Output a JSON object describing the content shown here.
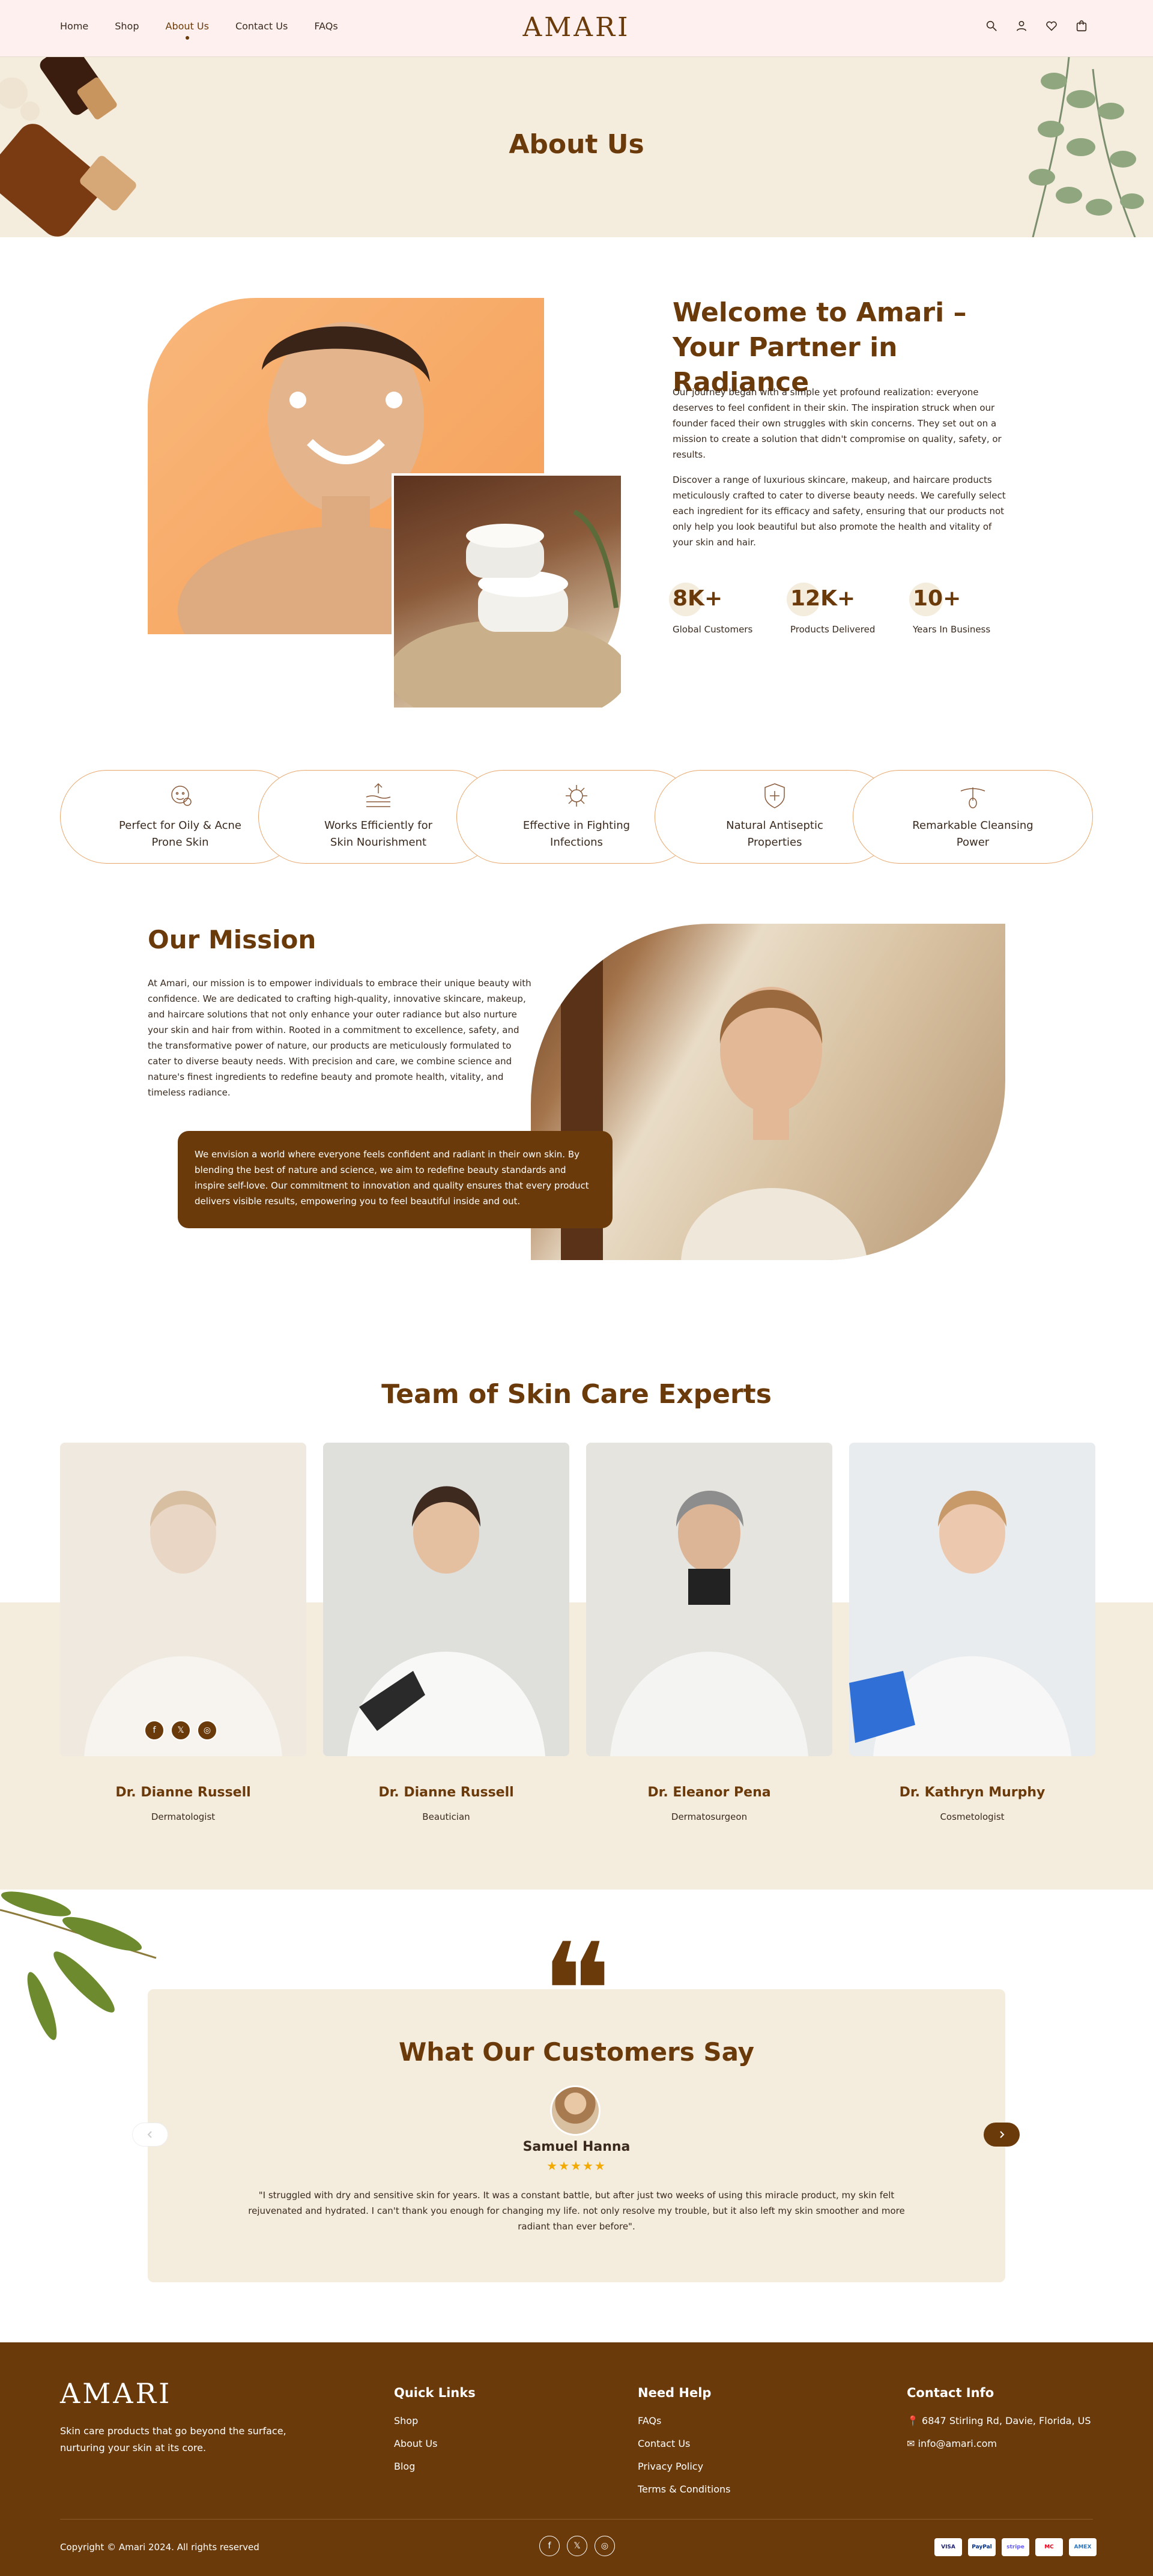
{
  "header": {
    "nav": [
      "Home",
      "Shop",
      "About Us",
      "Contact Us",
      "FAQs"
    ],
    "logo": "AMARI",
    "icons": [
      "search-icon",
      "user-icon",
      "heart-icon",
      "cart-icon"
    ]
  },
  "banner": {
    "title": "About Us"
  },
  "welcome": {
    "title": "Welcome to Amari – Your Partner in Radiance",
    "p1": "Our journey began with a simple yet profound realization: everyone deserves to feel confident in their skin. The inspiration struck when our founder faced their own struggles with skin concerns. They set out on a mission to create a solution that didn't compromise on quality, safety, or results.",
    "p2": "Discover a range of luxurious skincare, makeup, and haircare products meticulously crafted to cater to diverse beauty needs. We carefully select each ingredient for its efficacy and safety, ensuring that our products not only help you look beautiful but also promote the health and vitality of your skin and hair.",
    "stats": [
      {
        "num": "8K+",
        "label": "Global Customers"
      },
      {
        "num": "12K+",
        "label": "Products Delivered"
      },
      {
        "num": "10+",
        "label": "Years In Business"
      }
    ]
  },
  "features": [
    {
      "l1": "Perfect for Oily & Acne",
      "l2": "Prone Skin",
      "icon": "face-icon"
    },
    {
      "l1": "Works Efficiently for",
      "l2": "Skin Nourishment",
      "icon": "skin-layers-icon"
    },
    {
      "l1": "Effective in Fighting",
      "l2": "Infections",
      "icon": "virus-icon"
    },
    {
      "l1": "Natural Antiseptic",
      "l2": "Properties",
      "icon": "shield-plus-icon"
    },
    {
      "l1": "Remarkable Cleansing",
      "l2": "Power",
      "icon": "hair-follicle-icon"
    }
  ],
  "mission": {
    "title": "Our Mission",
    "text": "At Amari, our mission is to empower individuals to embrace their unique beauty with confidence. We are dedicated to crafting high-quality, innovative skincare, makeup, and haircare solutions that not only enhance your outer radiance but also nurture your skin and hair from within. Rooted in a commitment to excellence, safety, and the transformative power of nature, our products are meticulously formulated to cater to diverse beauty needs. With precision and care, we combine science and nature's finest ingredients to redefine beauty and promote health, vitality, and timeless radiance.",
    "vision": "We envision a world where everyone feels confident and radiant in their own skin. By blending the best of nature and science, we aim to redefine beauty standards and inspire self-love. Our commitment to innovation and quality ensures that every product delivers visible results, empowering you to feel beautiful inside and out."
  },
  "team": {
    "title": "Team of Skin Care Experts",
    "members": [
      {
        "name": "Dr. Dianne Russell",
        "role": "Dermatologist"
      },
      {
        "name": "Dr. Dianne Russell",
        "role": "Beautician"
      },
      {
        "name": "Dr. Eleanor Pena",
        "role": "Dermatosurgeon"
      },
      {
        "name": "Dr. Kathryn Murphy",
        "role": "Cosmetologist"
      }
    ],
    "social": [
      "facebook-icon",
      "x-icon",
      "instagram-icon"
    ]
  },
  "testimonials": {
    "title": "What Our Customers Say",
    "name": "Samuel Hanna",
    "stars": "★★★★★",
    "rating": 5,
    "text": "\"I struggled with dry and sensitive skin for years. It was a constant battle, but after just two weeks of using this miracle product, my skin felt rejuvenated and hydrated. I can't thank you enough for changing my life. not only resolve my trouble, but it also left my skin smoother and more radiant than ever before\"."
  },
  "footer": {
    "logo": "AMARI",
    "tagline": "Skin care products that go beyond the surface, nurturing your skin at its core.",
    "quick_title": "Quick Links",
    "quick": [
      "Shop",
      "About Us",
      "Blog"
    ],
    "help_title": "Need Help",
    "help": [
      "FAQs",
      "Contact Us",
      "Privacy Policy",
      "Terms & Conditions"
    ],
    "contact_title": "Contact Info",
    "address": "6847 Stirling Rd, Davie, Florida, US",
    "email": "info@amari.com",
    "copyright": "Copyright © Amari 2024. All rights reserved",
    "payments": [
      "VISA",
      "PayPal",
      "stripe",
      "MC",
      "AMEX"
    ]
  },
  "colors": {
    "brand": "#6b3a0a",
    "cream": "#f4ecdc",
    "header_bg": "#fdf0ee",
    "star": "#f2a900"
  }
}
